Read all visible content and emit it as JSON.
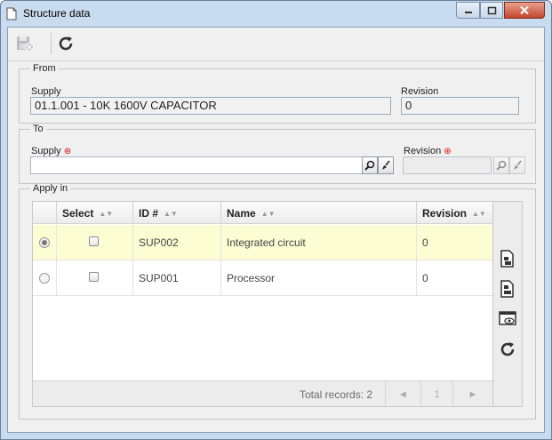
{
  "window": {
    "title": "Structure data"
  },
  "toolbar": {
    "save_icon": "save-icon",
    "refresh_icon": "refresh-icon"
  },
  "from": {
    "legend": "From",
    "supply_label": "Supply",
    "supply_value": "01.1.001 - 10K 1600V CAPACITOR",
    "revision_label": "Revision",
    "revision_value": "0"
  },
  "to": {
    "legend": "To",
    "supply_label": "Supply",
    "supply_value": "",
    "revision_label": "Revision",
    "revision_value": ""
  },
  "apply_in": {
    "legend": "Apply in",
    "columns": [
      "Select",
      "ID #",
      "Name",
      "Revision"
    ],
    "rows": [
      {
        "id": "SUP002",
        "name": "Integrated circuit",
        "revision": "0",
        "radio_selected": true,
        "checked": false
      },
      {
        "id": "SUP001",
        "name": "Processor",
        "revision": "0",
        "radio_selected": false,
        "checked": false
      }
    ],
    "total_records": "Total records: 2",
    "pager": {
      "prev": "◄",
      "page": "1",
      "next": "►"
    }
  },
  "colors": {
    "accent": "#c9dbee",
    "selected_row": "#fdfdd4",
    "required": "#dd0000"
  }
}
